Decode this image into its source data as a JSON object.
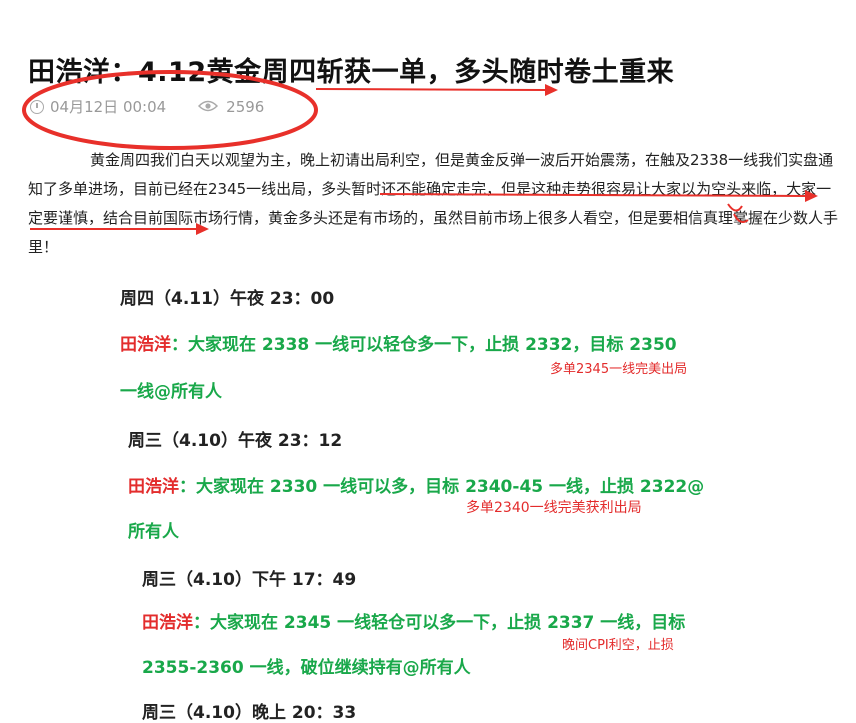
{
  "article": {
    "title": "田浩洋：4.12黄金周四斩获一单，多头随时卷土重来",
    "date": "04月12日 00:04",
    "views": "2596",
    "paragraph": "黄金周四我们白天以观望为主，晚上初请出局利空，但是黄金反弹一波后开始震荡，在触及2338一线我们实盘通知了多单进场，目前已经在2345一线出局，多头暂时还不能确定走完，但是这种走势很容易让大家以为空头来临，大家一定要谨慎，结合目前国际市场行情，黄金多头还是有市场的，虽然目前市场上很多人看空，但是要相信真理掌握在少数人手里！"
  },
  "records": [
    {
      "heading": "周四（4.11）午夜 23：00",
      "author": "田浩洋",
      "line1": "：大家现在 2338 一线可以轻仓多一下，止损 2332，目标 2350",
      "line2": "一线@所有人",
      "note": "多单2345一线完美出局"
    },
    {
      "heading": "周三（4.10）午夜 23：12",
      "author": "田浩洋",
      "line1": "：大家现在 2330 一线可以多，目标 2340-45 一线，止损 2322@",
      "line2": "所有人",
      "note": "多单2340一线完美获利出局"
    },
    {
      "heading": "周三（4.10）下午 17：49",
      "author": "田浩洋",
      "line1": "：大家现在 2345 一线轻仓可以多一下，止损 2337 一线，目标",
      "line2": "2355-2360 一线，破位继续持有@所有人",
      "note": "晚间CPI利空，止损"
    },
    {
      "heading": "周三（4.10）晚上 20：33"
    }
  ],
  "colors": {
    "accent_red": "#e32c2c",
    "accent_green": "#19a84a",
    "annotation": "#e8302a"
  },
  "icons": {
    "date": "clock-icon",
    "views": "eye-icon"
  }
}
